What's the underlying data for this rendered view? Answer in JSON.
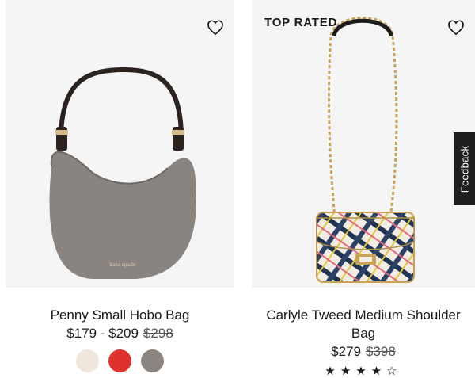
{
  "products": [
    {
      "name": "Penny Small Hobo Bag",
      "price": "$179 - $209",
      "original_price": "$298",
      "swatches": [
        "#efe6de",
        "#e0322c",
        "#8c8580"
      ]
    },
    {
      "badge": "TOP RATED",
      "name": "Carlyle Tweed Medium Shoulder Bag",
      "price": "$279",
      "original_price": "$398",
      "stars": "★★★★☆"
    }
  ],
  "feedback_label": "Feedback",
  "icons": {
    "wishlist": "heart-outline-icon"
  }
}
